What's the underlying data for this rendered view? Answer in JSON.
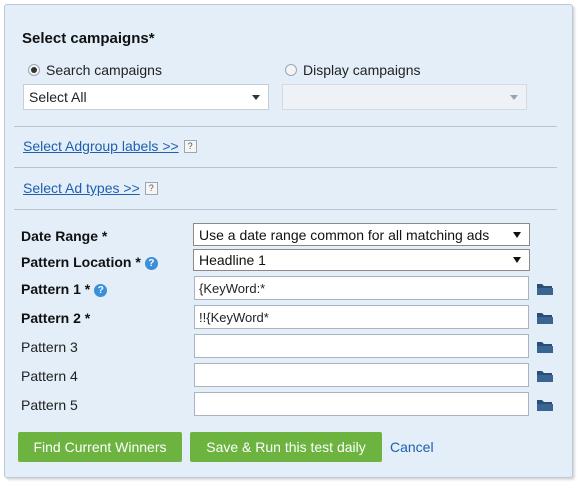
{
  "title": "Select campaigns*",
  "campaign_type": {
    "search_label": "Search campaigns",
    "display_label": "Display campaigns",
    "selected": "search"
  },
  "search_select": {
    "value": "Select All"
  },
  "display_select": {
    "value": ""
  },
  "links": {
    "adgroup_labels": "Select Adgroup labels >>",
    "ad_types": "Select Ad types >>",
    "help_mark": "?"
  },
  "form": {
    "date_range_label": "Date Range *",
    "date_range_value": "Use a date range common for all matching ads",
    "pattern_location_label": "Pattern Location *",
    "pattern_location_value": "Headline 1",
    "help_glyph": "?",
    "patterns": [
      {
        "label": "Pattern 1 *",
        "value": "{KeyWord:*",
        "required": true,
        "help": true
      },
      {
        "label": "Pattern 2 *",
        "value": "!!{KeyWord*",
        "required": true,
        "help": false
      },
      {
        "label": "Pattern 3",
        "value": "",
        "required": false,
        "help": false
      },
      {
        "label": "Pattern 4",
        "value": "",
        "required": false,
        "help": false
      },
      {
        "label": "Pattern 5",
        "value": "",
        "required": false,
        "help": false
      }
    ]
  },
  "actions": {
    "find_winners": "Find Current Winners",
    "save_run": "Save & Run this test daily",
    "cancel": "Cancel"
  },
  "colors": {
    "panel_bg": "#e3eef8",
    "accent_green": "#6cb33f",
    "link_blue": "#1f5fb0",
    "folder_icon": "#2a4e76",
    "help_icon": "#3b8fd9"
  },
  "icons": {
    "folder": "folder-icon",
    "help": "help-circle-icon",
    "dropdown": "chevron-down-icon"
  }
}
